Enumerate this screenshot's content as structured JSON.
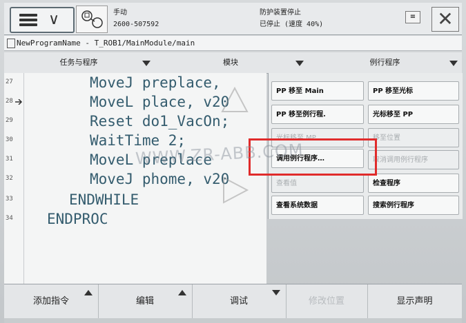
{
  "status": {
    "mode": "手动",
    "controller": "2600-507592",
    "state1": "防护装置停止",
    "state2": "已停止 (速度 40%)"
  },
  "program_path": "NewProgramName - T_ROB1/MainModule/main",
  "header": {
    "tab1": "任务与程序",
    "tab2": "模块",
    "tab3": "例行程序"
  },
  "code_lines": [
    {
      "num": "27",
      "text": "MoveJ preplace,"
    },
    {
      "num": "28",
      "text": "MoveL place, v20"
    },
    {
      "num": "29",
      "text": "Reset do1_VacOn;"
    },
    {
      "num": "30",
      "text": "WaitTime 2;"
    },
    {
      "num": "31",
      "text": "MoveL preplace"
    },
    {
      "num": "32",
      "text": "MoveJ phome, v20"
    },
    {
      "num": "33",
      "text": "ENDWHILE"
    },
    {
      "num": "34",
      "text": "ENDPROC"
    }
  ],
  "popup": {
    "pp_to_main": "PP 移至 Main",
    "pp_to_cursor": "PP 移至光标",
    "pp_to_routine": "PP 移至例行程.",
    "cursor_to_pp": "光标移至 PP",
    "cursor_to_mp": "光标移至 MP",
    "move_to_position": "移至位置",
    "call_routine": "调用例行程序…",
    "cancel_call_routine": "取消调用例行程序",
    "view_value": "查看值",
    "check_program": "检查程序",
    "view_system_data": "查看系统数据",
    "search_routine": "搜索例行程序"
  },
  "toolbar": {
    "add_instruction": "添加指令",
    "edit": "编辑",
    "debug": "调试",
    "modify_position": "修改位置",
    "show_declaration": "显示声明"
  },
  "watermark": "WWW.ZR-ABB.COM",
  "colors": {
    "code_text": "#345c6e",
    "highlight_box": "#e02b2b"
  }
}
